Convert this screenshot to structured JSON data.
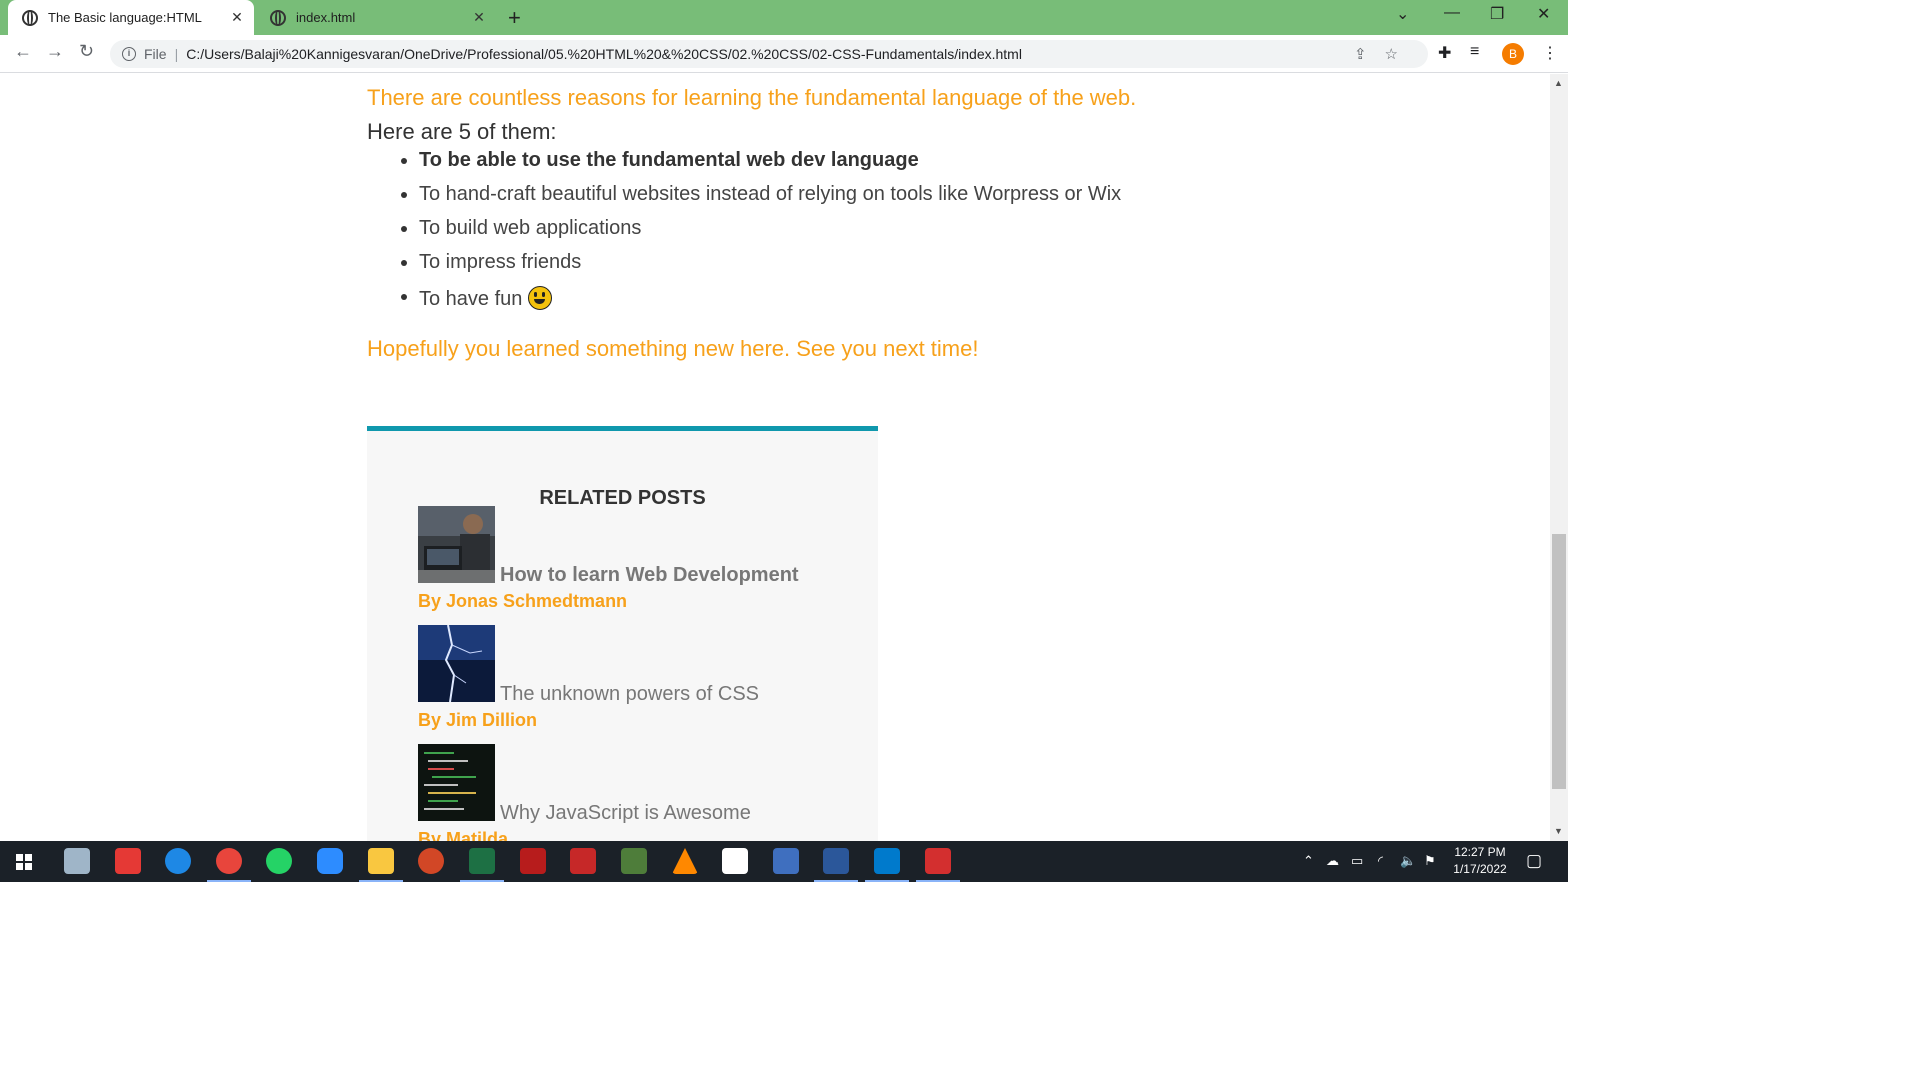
{
  "browser": {
    "tabs": [
      {
        "label": "The Basic language:HTML",
        "active": true
      },
      {
        "label": "index.html",
        "active": false
      }
    ],
    "address": {
      "scheme_label": "File",
      "url": "C:/Users/Balaji%20Kannigesvaran/OneDrive/Professional/05.%20HTML%20&%20CSS/02.%20CSS/02-CSS-Fundamentals/index.html"
    },
    "profile_initial": "B"
  },
  "page": {
    "intro": "There are countless reasons for learning the fundamental language of the web.",
    "list_heading": "Here are 5 of them:",
    "reasons": [
      "To be able to use the fundamental web dev language",
      "To hand-craft beautiful websites instead of relying on tools like Worpress or Wix",
      "To build web applications",
      "To impress friends",
      "To have fun"
    ],
    "closing": "Hopefully you learned something new here. See you next time!",
    "related": {
      "heading": "RELATED POSTS",
      "posts": [
        {
          "title": "How to learn Web Development",
          "author": "By Jonas Schmedtmann"
        },
        {
          "title": "The unknown powers of CSS",
          "author": "By Jim Dillion"
        },
        {
          "title": "Why JavaScript is Awesome",
          "author": "By Matilda"
        }
      ]
    }
  },
  "taskbar": {
    "time": "12:27 PM",
    "date": "1/17/2022"
  },
  "colors": {
    "accent_orange": "#f7a11b",
    "related_border": "#1098ad",
    "tabbar_bg": "#78bd78"
  }
}
